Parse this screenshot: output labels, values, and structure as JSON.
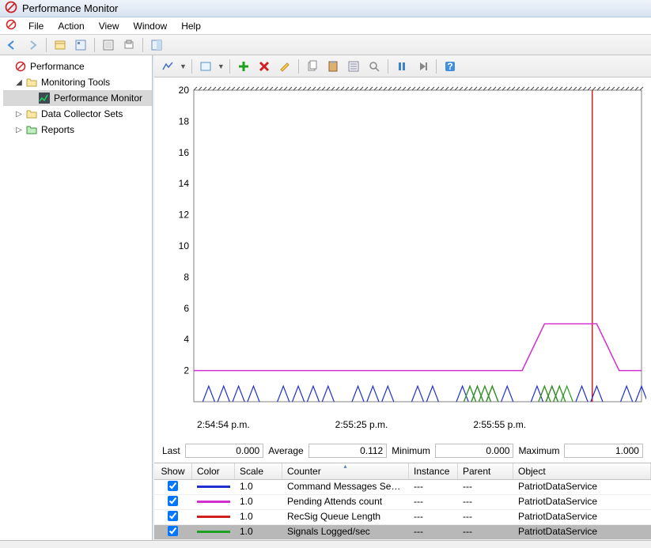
{
  "title": "Performance Monitor",
  "menu": [
    "File",
    "Action",
    "View",
    "Window",
    "Help"
  ],
  "tree": {
    "root": "Performance",
    "monitoring_tools": "Monitoring Tools",
    "perf_monitor": "Performance Monitor",
    "data_collector": "Data Collector Sets",
    "reports": "Reports"
  },
  "stats": {
    "last_label": "Last",
    "last": "0.000",
    "avg_label": "Average",
    "avg": "0.112",
    "min_label": "Minimum",
    "min": "0.000",
    "max_label": "Maximum",
    "max": "1.000"
  },
  "columns": {
    "show": "Show",
    "color": "Color",
    "scale": "Scale",
    "counter": "Counter",
    "instance": "Instance",
    "parent": "Parent",
    "object": "Object"
  },
  "rows": [
    {
      "color": "#2030d0",
      "scale": "1.0",
      "counter": "Command Messages Sen...",
      "instance": "---",
      "parent": "---",
      "object": "PatriotDataService"
    },
    {
      "color": "#d030d0",
      "scale": "1.0",
      "counter": "Pending Attends count",
      "instance": "---",
      "parent": "---",
      "object": "PatriotDataService"
    },
    {
      "color": "#d02020",
      "scale": "1.0",
      "counter": "RecSig Queue Length",
      "instance": "---",
      "parent": "---",
      "object": "PatriotDataService"
    },
    {
      "color": "#20a020",
      "scale": "1.0",
      "counter": "Signals Logged/sec",
      "instance": "---",
      "parent": "---",
      "object": "PatriotDataService"
    }
  ],
  "chart_data": {
    "type": "line",
    "ylim": [
      0,
      20
    ],
    "ylabel_ticks": [
      2,
      4,
      6,
      8,
      10,
      12,
      14,
      16,
      18,
      20
    ],
    "x_labels": [
      "2:54:54 p.m.",
      "2:55:25 p.m.",
      "2:55:55 p.m."
    ],
    "time_bar_position": 0.89,
    "series": [
      {
        "name": "Command Messages Sent/sec",
        "color": "#2030d0",
        "spikes_at": [
          2,
          4,
          6,
          8,
          12,
          14,
          16,
          18,
          22,
          24,
          26,
          30,
          32,
          36,
          38,
          40,
          42,
          46,
          48,
          52,
          54,
          58,
          60
        ],
        "spike_value": 1
      },
      {
        "name": "Pending Attends count",
        "color": "#d030d0",
        "points": [
          [
            0,
            2
          ],
          [
            44,
            2
          ],
          [
            47,
            5
          ],
          [
            54,
            5
          ],
          [
            57,
            2
          ],
          [
            60,
            2
          ]
        ]
      },
      {
        "name": "RecSig Queue Length",
        "color": "#d02020",
        "spikes_at": [
          37,
          38,
          39,
          40,
          47,
          48,
          49
        ],
        "spike_value": 1
      },
      {
        "name": "Signals Logged/sec",
        "color": "#20a020",
        "spikes_at": [
          37,
          38,
          39,
          40,
          47,
          48,
          49,
          50
        ],
        "spike_value": 1
      }
    ]
  }
}
